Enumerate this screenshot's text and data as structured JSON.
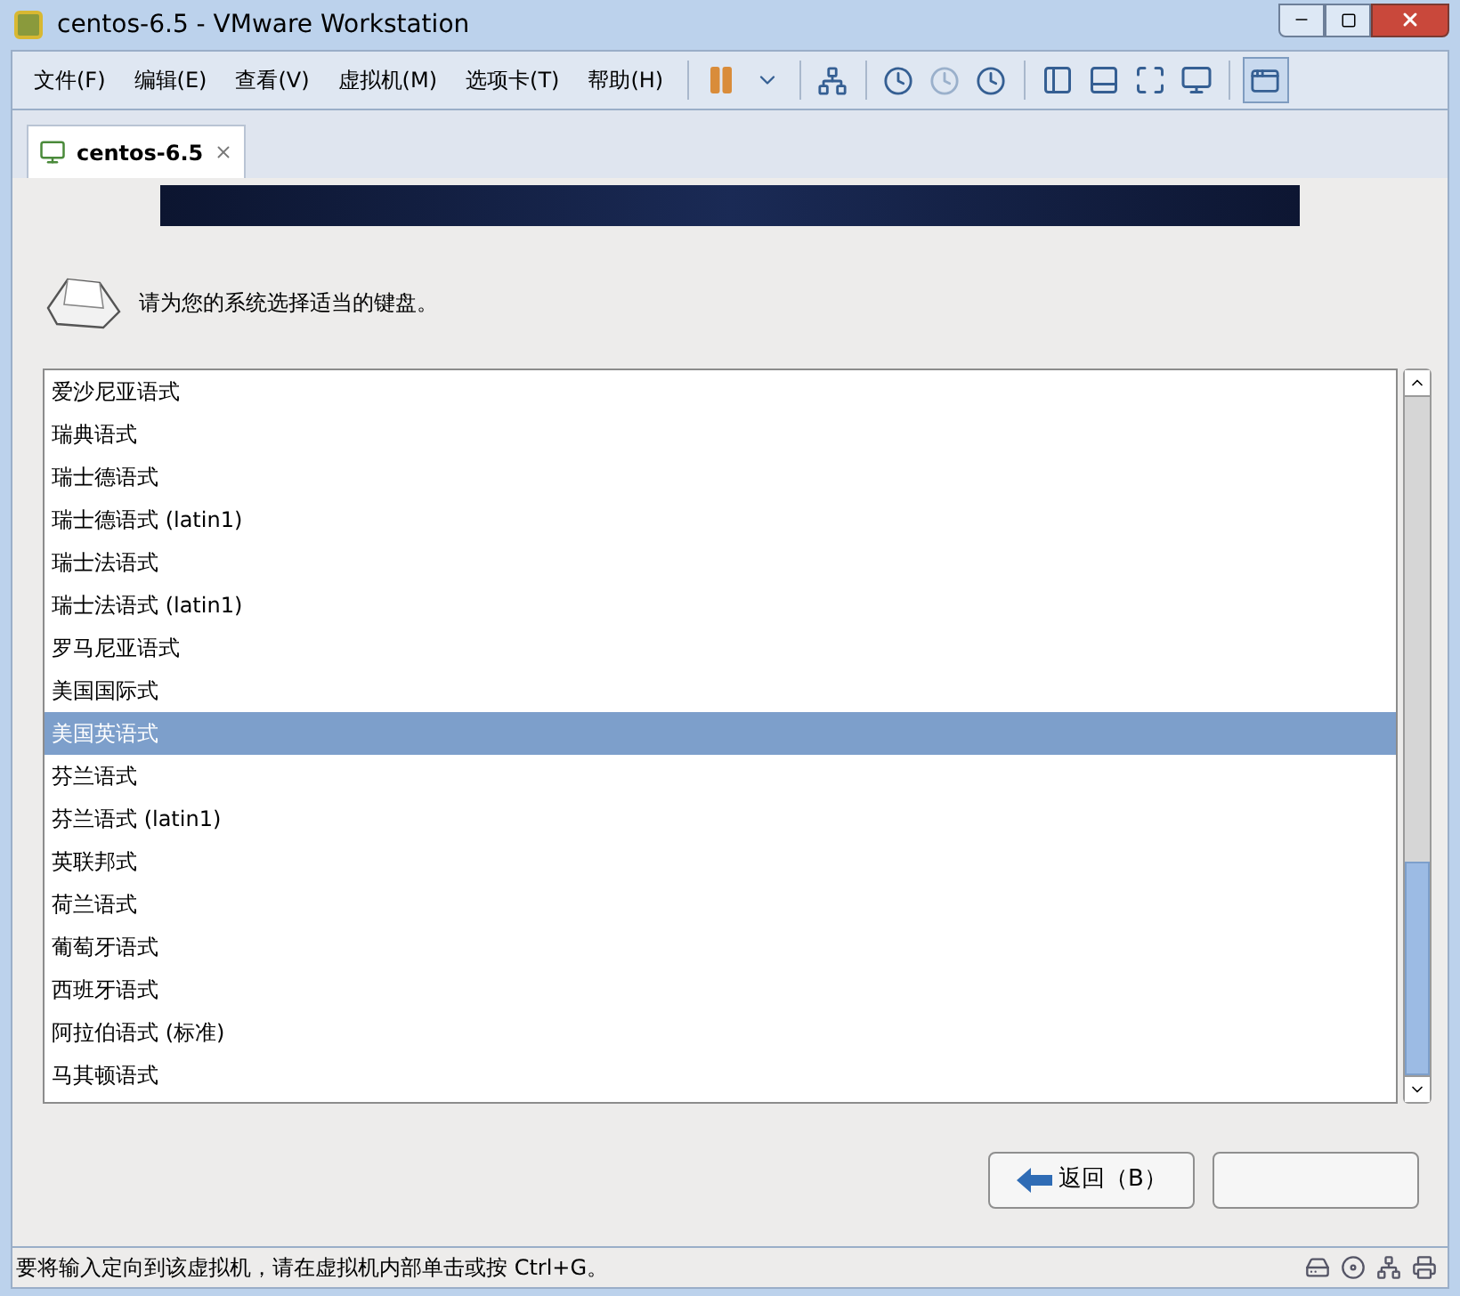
{
  "window": {
    "title": "centos-6.5 - VMware Workstation"
  },
  "menu": [
    "文件(F)",
    "编辑(E)",
    "查看(V)",
    "虚拟机(M)",
    "选项卡(T)",
    "帮助(H)"
  ],
  "tabs": [
    {
      "label": "centos-6.5",
      "selected": true
    }
  ],
  "installer": {
    "prompt": "请为您的系统选择适当的键盘。",
    "layouts": [
      {
        "label": "爱沙尼亚语式",
        "selected": false
      },
      {
        "label": "瑞典语式",
        "selected": false
      },
      {
        "label": "瑞士德语式",
        "selected": false
      },
      {
        "label": "瑞士德语式 (latin1)",
        "selected": false
      },
      {
        "label": "瑞士法语式",
        "selected": false
      },
      {
        "label": "瑞士法语式 (latin1)",
        "selected": false
      },
      {
        "label": "罗马尼亚语式",
        "selected": false
      },
      {
        "label": "美国国际式",
        "selected": false
      },
      {
        "label": "美国英语式",
        "selected": true
      },
      {
        "label": "芬兰语式",
        "selected": false
      },
      {
        "label": "芬兰语式 (latin1)",
        "selected": false
      },
      {
        "label": "英联邦式",
        "selected": false
      },
      {
        "label": "荷兰语式",
        "selected": false
      },
      {
        "label": "葡萄牙语式",
        "selected": false
      },
      {
        "label": "西班牙语式",
        "selected": false
      },
      {
        "label": "阿拉伯语式 (标准)",
        "selected": false
      },
      {
        "label": "马其顿语式",
        "selected": false
      }
    ],
    "back_button": "返回（B）"
  },
  "status_bar": {
    "text": "要将输入定向到该虚拟机，请在虚拟机内部单击或按 Ctrl+G。"
  }
}
